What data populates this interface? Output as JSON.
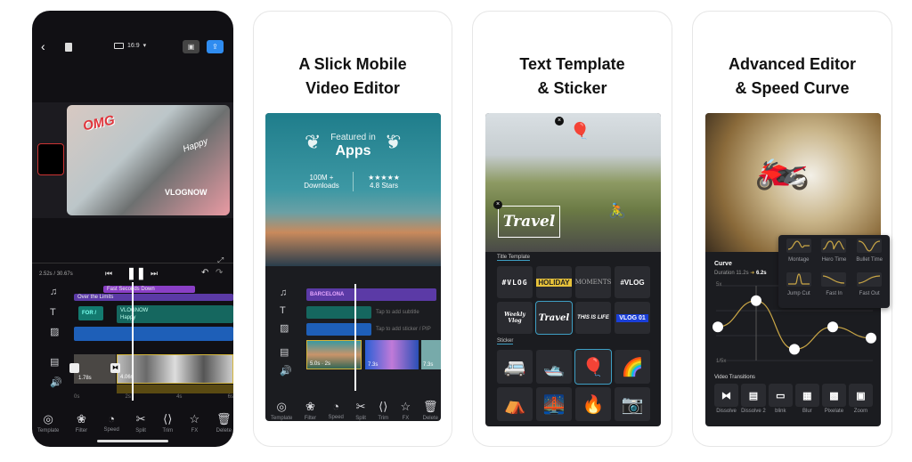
{
  "panel1": {
    "aspect_label": "16:9",
    "preview_stickers": {
      "omg": "OMG",
      "vlognow": "VLOGNOW",
      "handwriting": "Happy"
    },
    "time_current": "2.52s",
    "time_total": "30.67s",
    "tracks": {
      "music_top": "Fast Seconds Down",
      "music_bottom": "Over the Limits",
      "text_title": "FOR /",
      "text_a": "VLOGNOW",
      "text_b": "Happy",
      "clip_a_duration": "1.78s",
      "clip_b_duration": "4.06s"
    },
    "ruler": [
      "0s",
      "2s",
      "4s",
      "6s"
    ],
    "toolbar": [
      "Template",
      "Filter",
      "Speed",
      "Split",
      "Trim",
      "FX",
      "Delete"
    ]
  },
  "panel2": {
    "headline": [
      "A Slick Mobile",
      "Video Editor"
    ],
    "featured_line1": "Featured in",
    "featured_line2": "Apps",
    "downloads_value": "100M +",
    "downloads_label": "Downloads",
    "stars": "★★★★★",
    "rating_label": "4.8 Stars",
    "music_track": "BARCELONA",
    "subtitle_hint": "Tap to add subtitle",
    "sticker_hint": "Tap to add sticker / PIP",
    "clip_a_duration": "5.0s · 2s",
    "clip_b_duration": "7.3s",
    "clip_c_duration": "7.3s",
    "toolbar": [
      "Template",
      "Filter",
      "Speed",
      "Split",
      "Trim",
      "FX",
      "Delete"
    ]
  },
  "panel3": {
    "headline": [
      "Text Template",
      "& Sticker"
    ],
    "overlay_text": "Travel",
    "section_title_template": "Title Template",
    "templates": [
      "#VLOG",
      "HOLIDAY",
      "MOMENTS",
      "#VLOG",
      "Weekly Vlog",
      "Travel",
      "THIS IS LIFE",
      "VLOG 01"
    ],
    "section_sticker": "Sticker",
    "stickers": [
      "🚐",
      "🛥️",
      "🎈",
      "🌈",
      "⛺",
      "🌉",
      "🔥",
      "📷"
    ]
  },
  "panel4": {
    "headline": [
      "Advanced Editor",
      "& Speed Curve"
    ],
    "curve_title": "Curve",
    "duration_label": "Duration 11.2s",
    "duration_new": "6.2s",
    "axis_top": "5x",
    "axis_bottom": "1/5x",
    "presets": [
      "Montage",
      "Hero Time",
      "Bullet Time",
      "Jump Cut",
      "Fast In",
      "Fast Out"
    ],
    "transitions_title": "Video Transitions",
    "transitions": [
      "Dissolve",
      "Dissolve 2",
      "blink",
      "Blur",
      "Pixelate",
      "Zoom"
    ],
    "curve_points": [
      0.45,
      0.8,
      0.15,
      0.45,
      0.3
    ]
  },
  "colors": {
    "accent_blue": "#2f8cf0",
    "curve_gold": "#c9a646",
    "selection": "#3e9fc4"
  }
}
